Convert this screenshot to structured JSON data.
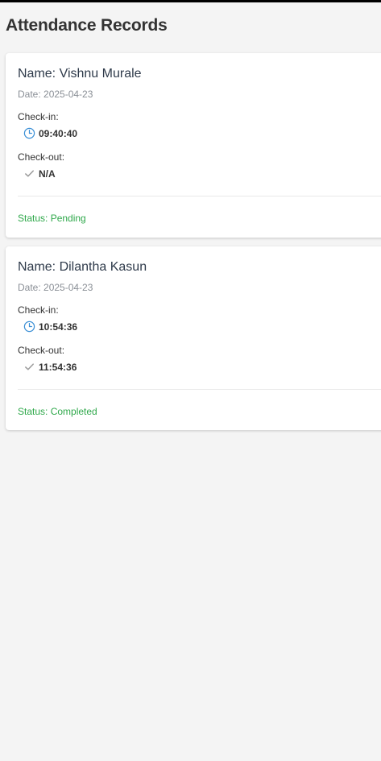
{
  "header": {
    "title": "Attendance Records"
  },
  "records": [
    {
      "name": "Name: Vishnu Murale",
      "date": "Date: 2025-04-23",
      "checkin_label": "Check-in:",
      "checkin_time": "09:40:40",
      "checkin_icon": "clock-icon",
      "checkout_label": "Check-out:",
      "checkout_time": "N/A",
      "checkout_icon": "check-icon",
      "status": "Status: Pending"
    },
    {
      "name": "Name: Dilantha Kasun",
      "date": "Date: 2025-04-23",
      "checkin_label": "Check-in:",
      "checkin_time": "10:54:36",
      "checkin_icon": "clock-icon",
      "checkout_label": "Check-out:",
      "checkout_time": "11:54:36",
      "checkout_icon": "check-icon",
      "status": "Status: Completed"
    }
  ],
  "colors": {
    "status_green": "#2ea84a",
    "clock_blue": "#3a8fd6",
    "check_gray": "#9a9a9a"
  }
}
